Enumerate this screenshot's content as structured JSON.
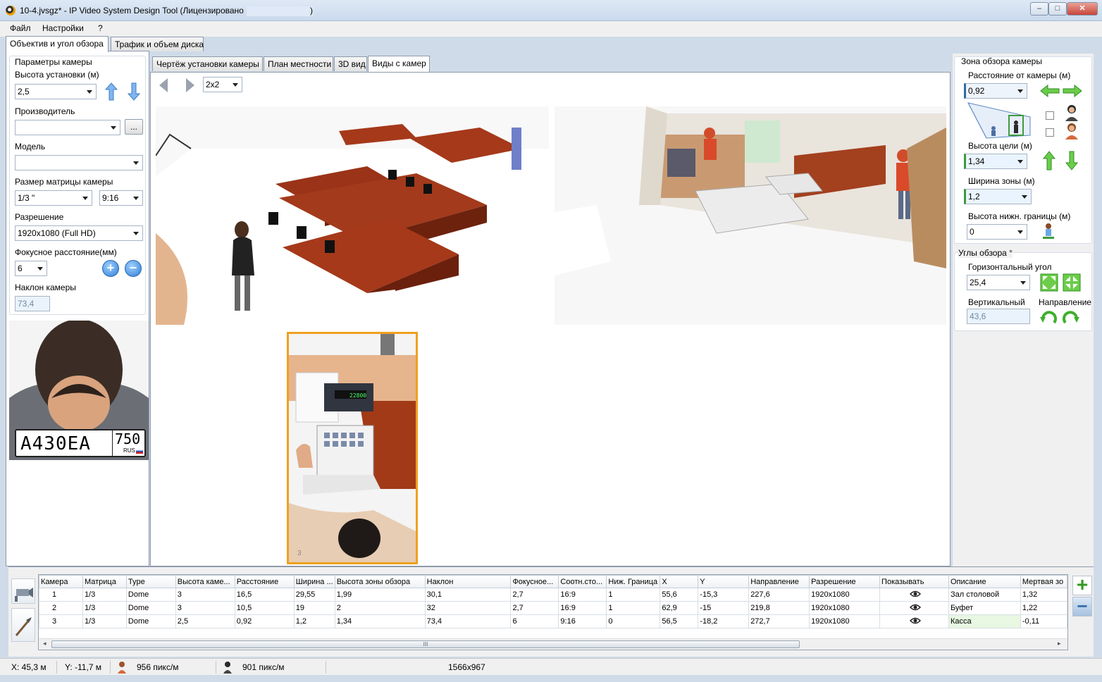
{
  "window": {
    "title": "10-4.jvsgz* - IP Video System Design Tool (Лицензировано",
    "title_end": ")",
    "minimize": "‒",
    "maximize": "□",
    "close": "✕"
  },
  "menu": [
    "Файл",
    "Настройки",
    "?"
  ],
  "main_tabs": [
    "Объектив и угол обзора",
    "Трафик и объем диска"
  ],
  "camera_params": {
    "group_title": "Параметры камеры",
    "height_label": "Высота установки (м)",
    "height_value": "2,5",
    "manufacturer_label": "Производитель",
    "manufacturer_value": "",
    "browse_button": "...",
    "model_label": "Модель",
    "model_value": "",
    "matrix_label": "Размер матрицы камеры",
    "matrix_value": "1/3 \"",
    "aspect_value": "9:16",
    "resolution_label": "Разрешение",
    "resolution_value": "1920x1080 (Full HD)",
    "focal_label": "Фокусное расстояние(мм)",
    "focal_value": "6",
    "tilt_label": "Наклон камеры",
    "tilt_value": "73,4"
  },
  "plate": {
    "text": "A430EA",
    "region": "750",
    "country": "RUS"
  },
  "view_tabs": [
    "Чертёж установки камеры",
    "План местности",
    "3D вид",
    "Виды с камер"
  ],
  "layout_select": "2x2",
  "camera_views": [
    {
      "label": "",
      "scene": "Зал столовой"
    },
    {
      "label": "",
      "scene": "Буфет"
    },
    {
      "label": "3",
      "scene": "Касса"
    }
  ],
  "register_display": "22800",
  "coverage": {
    "group_title": "Зона обзора камеры",
    "distance_label": "Расстояние от камеры (м)",
    "distance_value": "0,92",
    "target_height_label": "Высота цели (м)",
    "target_height_value": "1,34",
    "zone_width_label": "Ширина зоны (м)",
    "zone_width_value": "1,2",
    "lower_bound_label": "Высота нижн. границы (м)",
    "lower_bound_value": "0"
  },
  "angles": {
    "group_title": "Углы обзора °",
    "horizontal_label": "Горизонтальный угол",
    "horizontal_value": "25,4",
    "vertical_label": "Вертикальный",
    "vertical_value": "43,6",
    "direction_label": "Направление"
  },
  "table": {
    "columns": [
      "Камера",
      "Матрица",
      "Type",
      "Высота каме...",
      "Расстояние",
      "Ширина ...",
      "Высота зоны обзора",
      "Наклон",
      "Фокусное...",
      "Соотн.сто...",
      "Ниж. Граница",
      "X",
      "Y",
      "Направление",
      "Разрешение",
      "Показывать",
      "Описание",
      "Мертвая зо"
    ],
    "rows": [
      [
        "1",
        "1/3",
        "Dome",
        "3",
        "16,5",
        "29,55",
        "1,99",
        "30,1",
        "2,7",
        "16:9",
        "1",
        "55,6",
        "-15,3",
        "227,6",
        "1920x1080",
        "",
        "Зал столовой",
        "1,32"
      ],
      [
        "2",
        "1/3",
        "Dome",
        "3",
        "10,5",
        "19",
        "2",
        "32",
        "2,7",
        "16:9",
        "1",
        "62,9",
        "-15",
        "219,8",
        "1920x1080",
        "",
        "Буфет",
        "1,22"
      ],
      [
        "3",
        "1/3",
        "Dome",
        "2,5",
        "0,92",
        "1,2",
        "1,34",
        "73,4",
        "6",
        "9:16",
        "0",
        "56,5",
        "-18,2",
        "272,7",
        "1920x1080",
        "",
        "Касса",
        "-0,11"
      ]
    ],
    "scroll_grip": "III",
    "add_button": "+",
    "remove_button": "−"
  },
  "status": {
    "x": "X: 45,3 м",
    "y": "Y: -11,7 м",
    "density_female": "956 пикс/м",
    "density_male": "901 пикс/м",
    "size": "1566x967"
  }
}
